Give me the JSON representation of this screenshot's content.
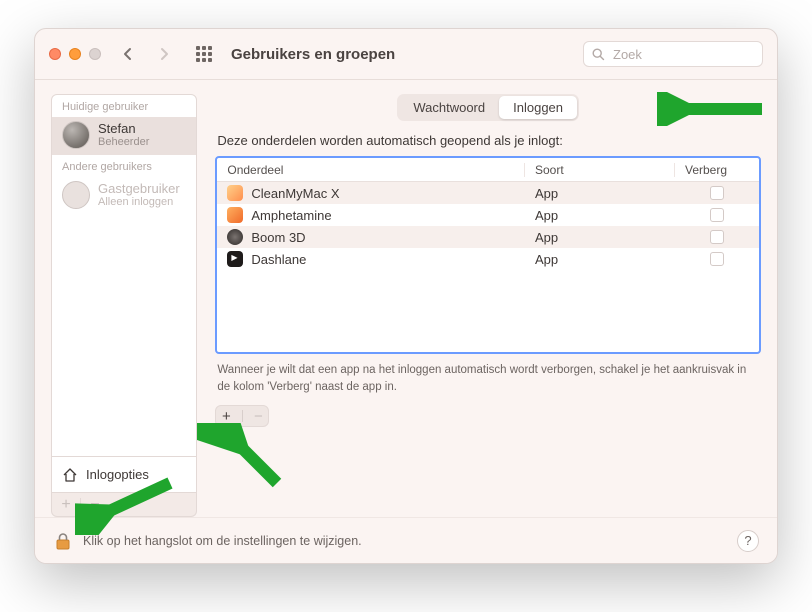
{
  "toolbar": {
    "title": "Gebruikers en groepen",
    "search_placeholder": "Zoek"
  },
  "sidebar": {
    "current_header": "Huidige gebruiker",
    "current_user": {
      "name": "Stefan",
      "role": "Beheerder"
    },
    "other_header": "Andere gebruikers",
    "guest": {
      "name": "Gastgebruiker",
      "role": "Alleen inloggen"
    },
    "login_options": "Inlogopties"
  },
  "segment": {
    "password": "Wachtwoord",
    "login": "Inloggen"
  },
  "main": {
    "lead": "Deze onderdelen worden automatisch geopend als je inlogt:",
    "columns": {
      "item": "Onderdeel",
      "kind": "Soort",
      "hide": "Verberg"
    },
    "rows": [
      {
        "name": "CleanMyMac X",
        "kind": "App"
      },
      {
        "name": "Amphetamine",
        "kind": "App"
      },
      {
        "name": "Boom 3D",
        "kind": "App"
      },
      {
        "name": "Dashlane",
        "kind": "App"
      }
    ],
    "hint": "Wanneer je wilt dat een app na het inloggen automatisch wordt verborgen, schakel je het aankruisvak in de kolom 'Verberg' naast de app in."
  },
  "footer": {
    "text": "Klik op het hangslot om de instellingen te wijzigen."
  }
}
